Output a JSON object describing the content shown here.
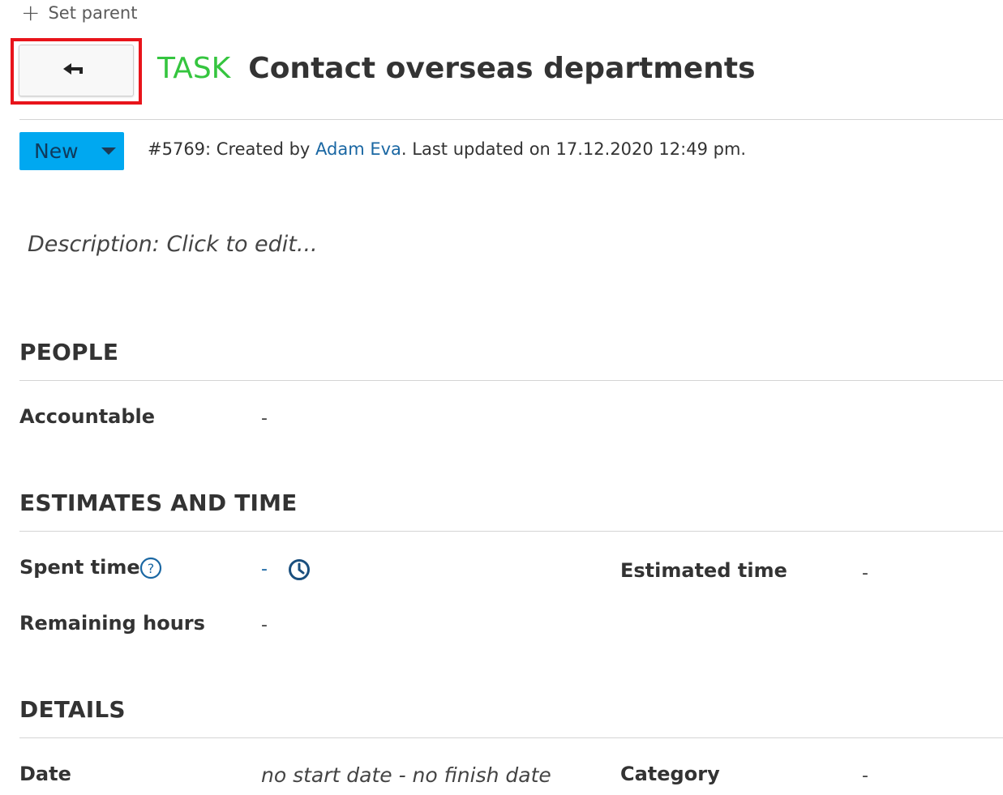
{
  "header": {
    "set_parent_label": "Set parent",
    "type_label": "TASK",
    "subject": "Contact overseas departments"
  },
  "status": {
    "label": "New"
  },
  "meta": {
    "prefix": "#5769: Created by ",
    "author": "Adam Eva",
    "suffix": ". Last updated on 17.12.2020 12:49 pm."
  },
  "description": {
    "placeholder": "Description: Click to edit..."
  },
  "sections": {
    "people": {
      "title": "PEOPLE",
      "accountable_label": "Accountable",
      "accountable_value": "-"
    },
    "estimates": {
      "title": "ESTIMATES AND TIME",
      "spent_time_label": "Spent time",
      "spent_time_value": "-",
      "estimated_time_label": "Estimated time",
      "estimated_time_value": "-",
      "remaining_hours_label": "Remaining hours",
      "remaining_hours_value": "-"
    },
    "details": {
      "title": "DETAILS",
      "date_label": "Date",
      "date_value": "no start date - no finish date",
      "category_label": "Category",
      "category_value": "-"
    }
  },
  "icons": {
    "set_parent": "plus-icon",
    "back": "back-arrow-icon",
    "status_dropdown": "caret-down-icon",
    "help": "help-circle-icon",
    "log_time": "clock-icon"
  },
  "colors": {
    "type_label": "#35c53f",
    "status_bg": "#00a8f0",
    "link": "#1a67a3",
    "highlight": "#e8141b"
  }
}
